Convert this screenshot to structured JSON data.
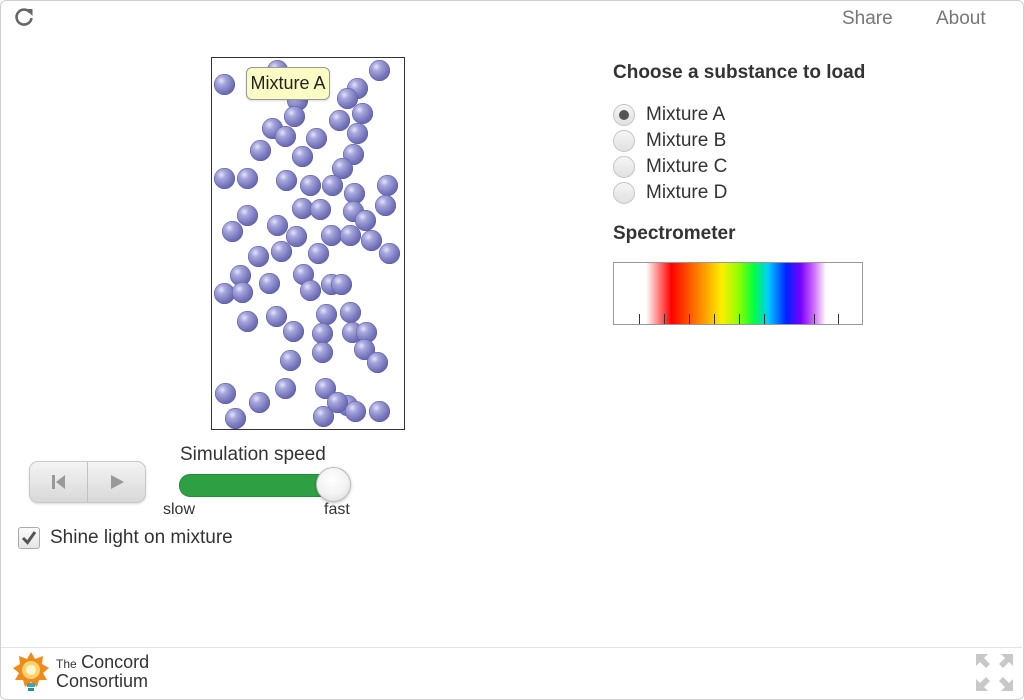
{
  "header": {
    "share": "Share",
    "about": "About",
    "reload_icon": "reload-icon"
  },
  "simulation": {
    "mixture_label": "Mixture A"
  },
  "playback": {
    "reset_icon": "skip-back-icon",
    "play_icon": "play-icon"
  },
  "speed": {
    "label": "Simulation speed",
    "min_label": "slow",
    "max_label": "fast",
    "value": 1.0
  },
  "shine_light": {
    "label": "Shine light on mixture",
    "checked": true
  },
  "substances": {
    "title": "Choose a substance to load",
    "options": [
      {
        "label": "Mixture A",
        "selected": true
      },
      {
        "label": "Mixture B",
        "selected": false
      },
      {
        "label": "Mixture C",
        "selected": false
      },
      {
        "label": "Mixture D",
        "selected": false
      }
    ]
  },
  "spectrometer": {
    "title": "Spectrometer"
  },
  "footer": {
    "logo_line1": "The",
    "logo_line2": "Concord",
    "logo_line3": "Consortium",
    "fullscreen_icon": "fullscreen-icon"
  },
  "colors": {
    "particle": "#7676bd",
    "slider_fill": "#2ea043",
    "label_bg": "#fbfbc4"
  }
}
